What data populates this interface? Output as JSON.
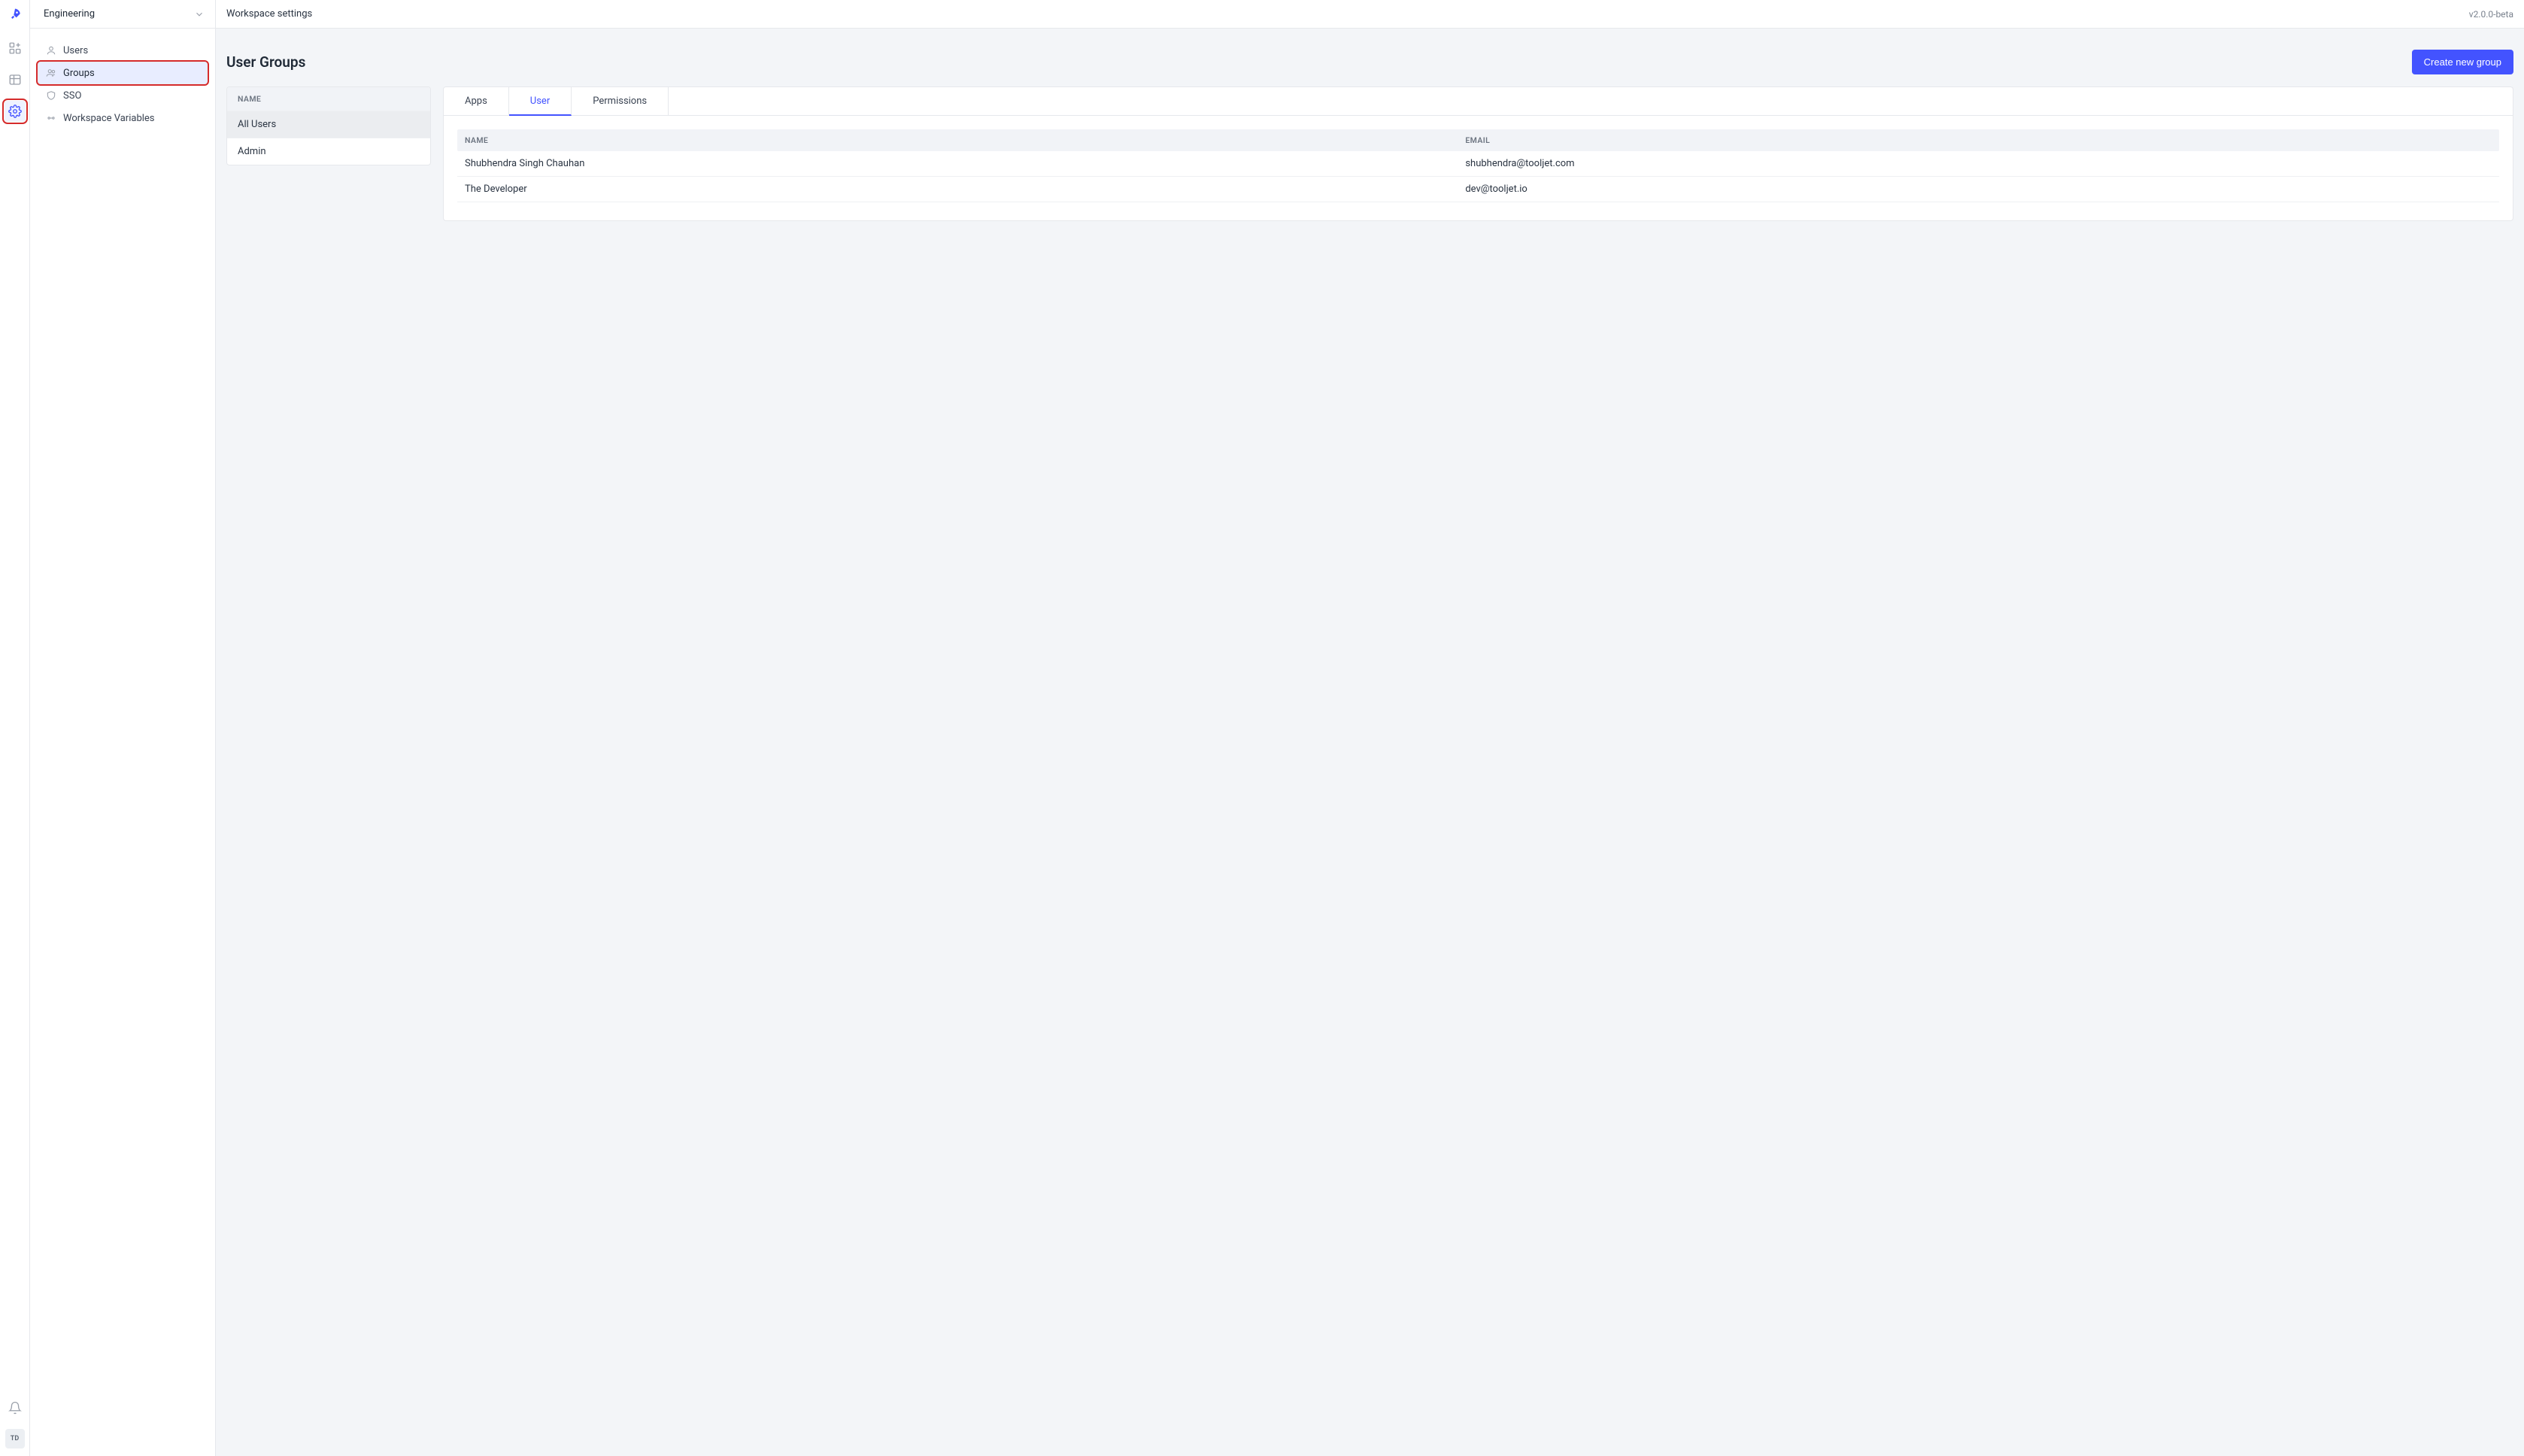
{
  "rail": {
    "avatar_initials": "TD"
  },
  "sidebar": {
    "workspace_name": "Engineering",
    "items": [
      {
        "label": "Users"
      },
      {
        "label": "Groups"
      },
      {
        "label": "SSO"
      },
      {
        "label": "Workspace Variables"
      }
    ],
    "active_index": 1
  },
  "header": {
    "title": "Workspace settings",
    "version": "v2.0.0-beta"
  },
  "main": {
    "page_title": "User Groups",
    "create_button_label": "Create new group",
    "groups_panel": {
      "header": "NAME",
      "rows": [
        "All Users",
        "Admin"
      ],
      "active_index": 0
    },
    "tabs": [
      "Apps",
      "User",
      "Permissions"
    ],
    "active_tab_index": 1,
    "users_table": {
      "columns": [
        "NAME",
        "EMAIL"
      ],
      "rows": [
        {
          "name": "Shubhendra Singh Chauhan",
          "email": "shubhendra@tooljet.com"
        },
        {
          "name": "The Developer",
          "email": "dev@tooljet.io"
        }
      ]
    }
  }
}
